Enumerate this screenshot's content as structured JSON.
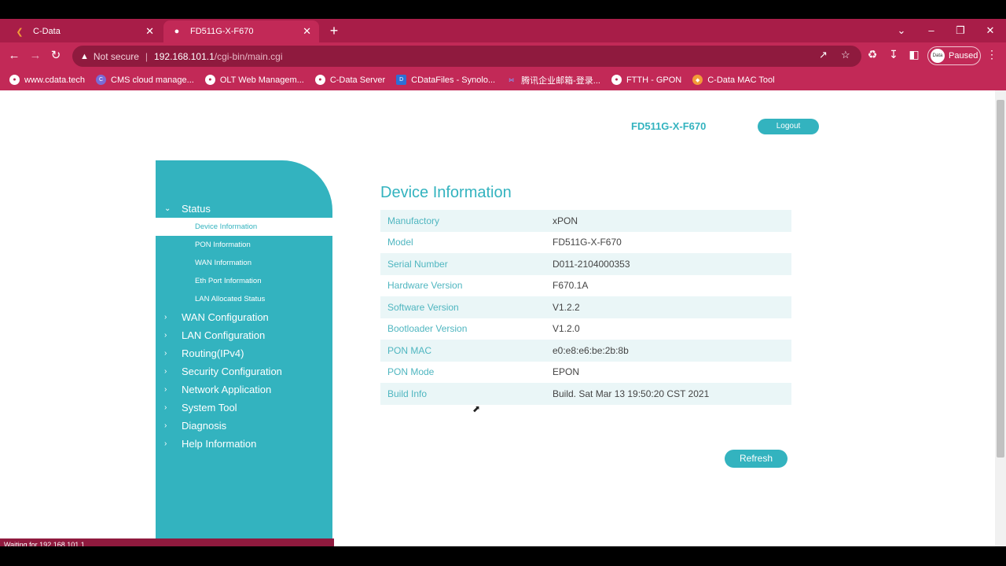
{
  "browser": {
    "tabs": [
      {
        "title": "C-Data",
        "icon": "cdata-logo-icon",
        "active": false
      },
      {
        "title": "FD511G-X-F670",
        "icon": "globe-icon",
        "active": true
      }
    ],
    "address": {
      "security": "Not secure",
      "host": "192.168.101.1",
      "path": "/cgi-bin/main.cgi"
    },
    "profile_status": "Paused",
    "profile_avatar_text": "Data",
    "bookmarks": [
      {
        "label": "www.cdata.tech",
        "icon": "globe-icon"
      },
      {
        "label": "CMS cloud manage...",
        "icon": "cms-icon"
      },
      {
        "label": "OLT Web Managem...",
        "icon": "globe-icon"
      },
      {
        "label": "C-Data Server",
        "icon": "globe-icon"
      },
      {
        "label": "CDataFiles - Synolo...",
        "icon": "dsm-icon"
      },
      {
        "label": "腾讯企业邮箱-登录...",
        "icon": "mail-icon"
      },
      {
        "label": "FTTH - GPON",
        "icon": "globe-icon"
      },
      {
        "label": "C-Data MAC Tool",
        "icon": "mac-tool-icon"
      }
    ],
    "status_text": "Waiting for 192.168.101.1..."
  },
  "header": {
    "device_name": "FD511G-X-F670",
    "logout_label": "Logout"
  },
  "sidebar": {
    "status_label": "Status",
    "status_items": [
      "Device Information",
      "PON Information",
      "WAN Information",
      "Eth Port Information",
      "LAN Allocated Status"
    ],
    "sections": [
      "WAN Configuration",
      "LAN Configuration",
      "Routing(IPv4)",
      "Security Configuration",
      "Network Application",
      "System Tool",
      "Diagnosis",
      "Help Information"
    ]
  },
  "main": {
    "title": "Device Information",
    "rows": [
      {
        "key": "Manufactory",
        "value": "xPON"
      },
      {
        "key": "Model",
        "value": "FD511G-X-F670"
      },
      {
        "key": "Serial Number",
        "value": "D011-2104000353"
      },
      {
        "key": "Hardware Version",
        "value": "F670.1A"
      },
      {
        "key": "Software Version",
        "value": "V1.2.2"
      },
      {
        "key": "Bootloader Version",
        "value": "V1.2.0"
      },
      {
        "key": "PON MAC",
        "value": "e0:e8:e6:be:2b:8b"
      },
      {
        "key": "PON Mode",
        "value": "EPON"
      },
      {
        "key": "Build Info",
        "value": "Build. Sat Mar 13 19:50:20 CST 2021"
      }
    ],
    "refresh_label": "Refresh"
  },
  "colors": {
    "accent": "#33b3bf",
    "browser_chrome": "#b5214f"
  }
}
